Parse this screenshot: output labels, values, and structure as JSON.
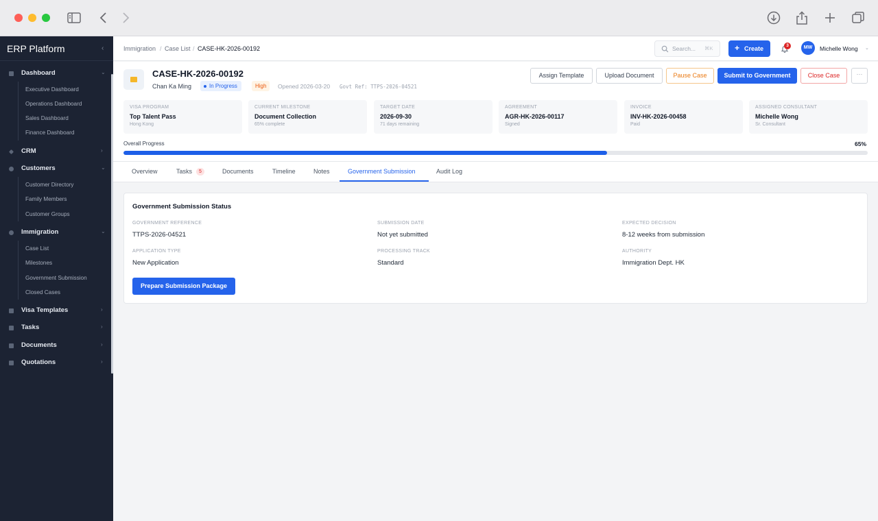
{
  "sidebar": {
    "brand": "ERP Platform",
    "sections": [
      {
        "label": "Dashboard",
        "subs": [
          "Executive Dashboard",
          "Operations Dashboard",
          "Sales Dashboard",
          "Finance Dashboard"
        ]
      },
      {
        "label": "CRM"
      },
      {
        "label": "Customers",
        "subs": [
          "Customer Directory",
          "Family Members",
          "Customer Groups"
        ]
      },
      {
        "label": "Immigration",
        "subs": [
          "Case List",
          "Milestones",
          "Government Submission",
          "Closed Cases"
        ]
      },
      {
        "label": "Visa Templates"
      },
      {
        "label": "Tasks"
      },
      {
        "label": "Documents"
      },
      {
        "label": "Quotations"
      }
    ]
  },
  "topbar": {
    "breadcrumb": [
      "Immigration",
      "Case List",
      "CASE-HK-2026-00192"
    ],
    "separator": "/",
    "search_placeholder": "Search...",
    "search_shortcut": "⌘K",
    "create_label": "Create",
    "notifications": "3",
    "user_initials": "MW",
    "user_name": "Michelle Wong"
  },
  "case": {
    "id": "CASE-HK-2026-00192",
    "client": "Chan Ka Ming",
    "status": "In Progress",
    "priority": "High",
    "opened": "Opened 2026-03-20",
    "govt_ref": "Govt Ref: TTPS-2026-04521",
    "actions": {
      "assign_template": "Assign Template",
      "upload_document": "Upload Document",
      "pause_case": "Pause Case",
      "submit_government": "Submit to Government",
      "close_case": "Close Case",
      "more": "···"
    },
    "stats": [
      {
        "key": "VISA PROGRAM",
        "value": "Top Talent Pass",
        "sub": "Hong Kong"
      },
      {
        "key": "CURRENT MILESTONE",
        "value": "Document Collection",
        "sub": "65% complete"
      },
      {
        "key": "TARGET DATE",
        "value": "2026-09-30",
        "sub": "71 days remaining"
      },
      {
        "key": "AGREEMENT",
        "value": "AGR-HK-2026-00117",
        "sub": "Signed"
      },
      {
        "key": "INVOICE",
        "value": "INV-HK-2026-00458",
        "sub": "Paid"
      },
      {
        "key": "ASSIGNED CONSULTANT",
        "value": "Michelle Wong",
        "sub": "Sr. Consultant"
      }
    ],
    "progress_label": "Overall Progress",
    "progress_text": "65%",
    "progress_value": 0.65
  },
  "tabs": {
    "items": [
      "Overview",
      "Tasks",
      "Documents",
      "Timeline",
      "Notes",
      "Government Submission",
      "Audit Log"
    ],
    "tasks_count": "5",
    "active": "Government Submission"
  },
  "submission": {
    "title": "Government Submission Status",
    "fields": [
      {
        "key": "GOVERNMENT REFERENCE",
        "value": "TTPS-2026-04521"
      },
      {
        "key": "SUBMISSION DATE",
        "value": "Not yet submitted"
      },
      {
        "key": "EXPECTED DECISION",
        "value": "8-12 weeks from submission"
      },
      {
        "key": "APPLICATION TYPE",
        "value": "New Application"
      },
      {
        "key": "PROCESSING TRACK",
        "value": "Standard"
      },
      {
        "key": "AUTHORITY",
        "value": "Immigration Dept. HK"
      }
    ],
    "prepare_label": "Prepare Submission Package"
  },
  "colors": {
    "accent": "#2563eb",
    "sidebar_bg": "#1c2333",
    "priority_high": "#ea580c",
    "danger": "#dc2626"
  }
}
